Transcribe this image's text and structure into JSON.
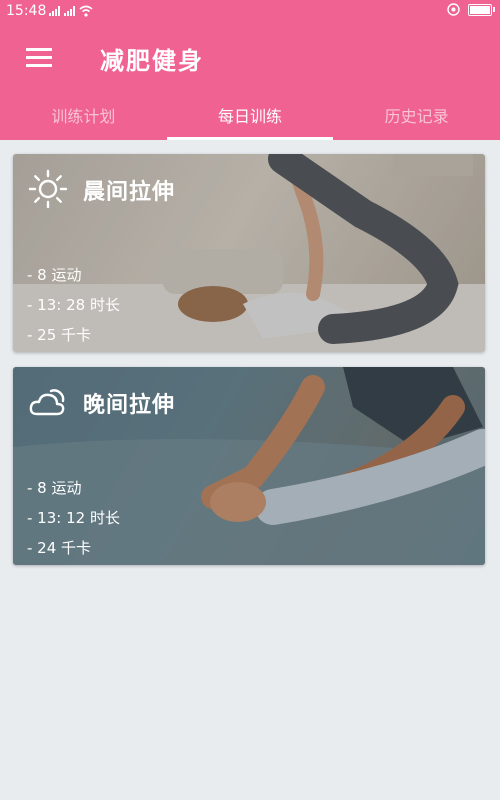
{
  "status_bar": {
    "time": "15:48",
    "icons": [
      "signal-icon",
      "signal-icon",
      "wifi-icon",
      "alarm-icon",
      "battery-icon"
    ]
  },
  "app_bar": {
    "menu_icon": "hamburger-menu-icon",
    "title": "减肥健身"
  },
  "tabs": [
    {
      "label": "训练计划",
      "active": false
    },
    {
      "label": "每日训练",
      "active": true
    },
    {
      "label": "历史记录",
      "active": false
    }
  ],
  "cards": [
    {
      "icon": "sun-icon",
      "title": "晨间拉伸",
      "stats": [
        "- 8 运动",
        "- 13: 28 时长",
        "- 25 千卡"
      ]
    },
    {
      "icon": "cloud-moon-icon",
      "title": "晚间拉伸",
      "stats": [
        "- 8 运动",
        "- 13: 12 时长",
        "- 24 千卡"
      ]
    }
  ],
  "colors": {
    "primary": "#f06292",
    "background": "#e8ecef",
    "tab_inactive": "#f8c4d4"
  }
}
